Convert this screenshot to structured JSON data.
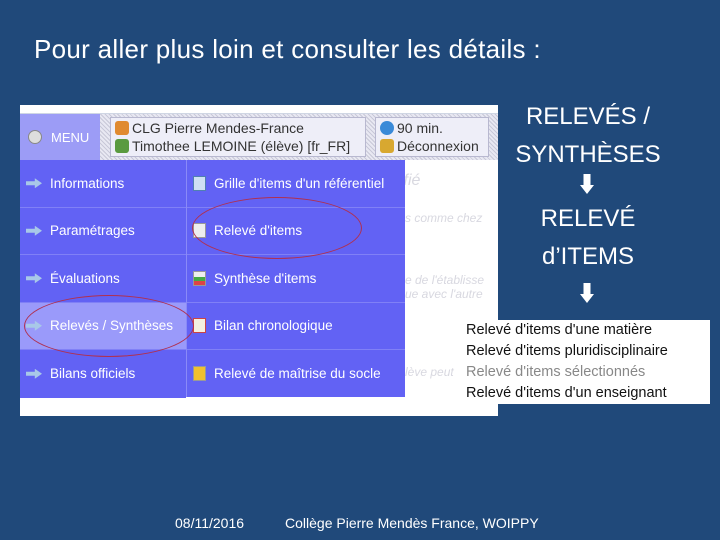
{
  "slide": {
    "title": "Pour aller plus loin et consulter les détails :",
    "right_labels": [
      "RELEVÉS /",
      "SYNTHÈSES",
      "RELEVÉ",
      "d’ITEMS"
    ],
    "footer_date": "08/11/2016",
    "footer_school": "Collège Pierre Mendès France, WOIPPY"
  },
  "header": {
    "menu_label": "MENU",
    "school": "CLG Pierre Mendes-France",
    "user": "Timothee LEMOINE (élève) [fr_FR]",
    "timer": "90 min.",
    "logout": "Déconnexion"
  },
  "menu": {
    "items": [
      {
        "label": "Informations"
      },
      {
        "label": "Paramétrages"
      },
      {
        "label": "Évaluations"
      },
      {
        "label": "Relevés / Synthèses",
        "selected": true
      },
      {
        "label": "Bilans officiels"
      }
    ]
  },
  "submenu": {
    "items": [
      {
        "label": "Grille d'items d'un référentiel",
        "icon": "grid-icon"
      },
      {
        "label": "Relevé d'items",
        "icon": "document-icon"
      },
      {
        "label": "Synthèse d'items",
        "icon": "synthesis-icon"
      },
      {
        "label": "Bilan chronologique",
        "icon": "chart-icon"
      },
      {
        "label": "Relevé de maîtrise du socle",
        "icon": "socle-icon"
      }
    ]
  },
  "background_text": [
    "ifié",
    "s comme chez",
    "e de l'établisse",
    "ue avec l'autre",
    "lève peut"
  ],
  "releve_list": [
    "Relevé d'items d'une matière",
    "Relevé d'items pluridisciplinaire",
    "Relevé d'items sélectionnés",
    "Relevé d'items d'un enseignant"
  ],
  "colors": {
    "slide_bg": "#20497a",
    "menu_bg": "#6262f4",
    "menu_selected": "#9a9afa"
  }
}
